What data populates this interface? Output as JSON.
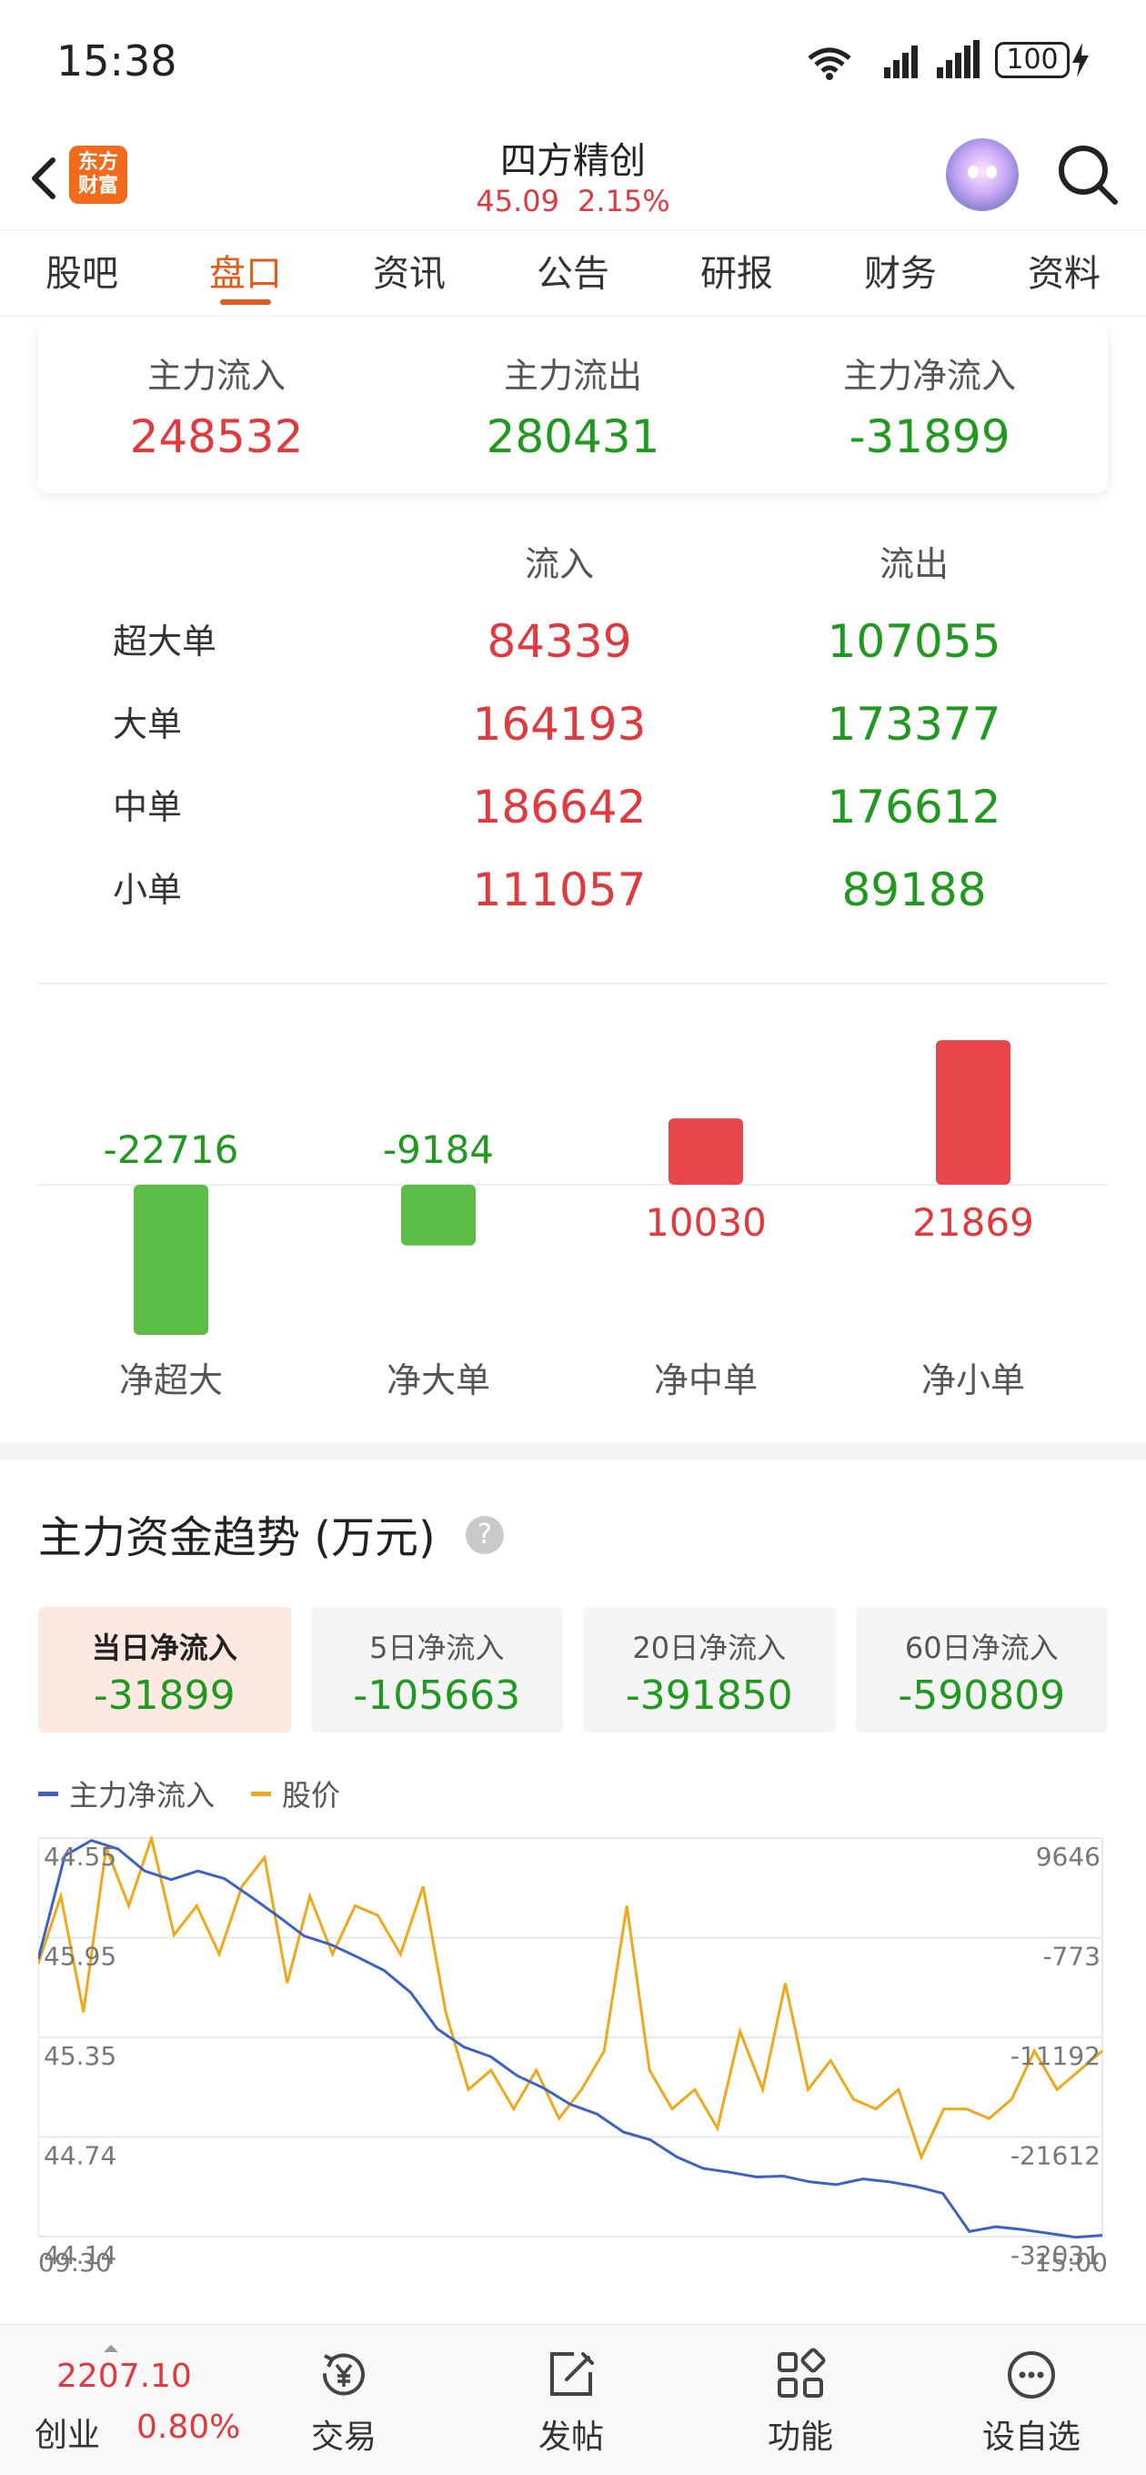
{
  "status_bar": {
    "time": "15:38",
    "wifi_label": "6",
    "network_label": "4G",
    "battery": "100"
  },
  "header": {
    "app_logo_text": [
      "东方",
      "财富"
    ],
    "title": "四方精创",
    "price": "45.09",
    "change_pct": "2.15%"
  },
  "tabs": [
    {
      "label": "股吧",
      "active": false
    },
    {
      "label": "盘口",
      "active": true
    },
    {
      "label": "资讯",
      "active": false
    },
    {
      "label": "公告",
      "active": false
    },
    {
      "label": "研报",
      "active": false
    },
    {
      "label": "财务",
      "active": false
    },
    {
      "label": "资料",
      "active": false
    }
  ],
  "main_flow": [
    {
      "label": "主力流入",
      "value": "248532",
      "tone": "red"
    },
    {
      "label": "主力流出",
      "value": "280431",
      "tone": "green"
    },
    {
      "label": "主力净流入",
      "value": "-31899",
      "tone": "green"
    }
  ],
  "flow_table": {
    "headers": {
      "in": "流入",
      "out": "流出"
    },
    "rows": [
      {
        "label": "超大单",
        "in": "84339",
        "out": "107055"
      },
      {
        "label": "大单",
        "in": "164193",
        "out": "173377"
      },
      {
        "label": "中单",
        "in": "186642",
        "out": "176612"
      },
      {
        "label": "小单",
        "in": "111057",
        "out": "89188"
      }
    ]
  },
  "chart_data": [
    {
      "type": "bar",
      "categories": [
        "净超大",
        "净大单",
        "净中单",
        "净小单"
      ],
      "values": [
        -22716,
        -9184,
        10030,
        21869
      ],
      "data_labels": [
        "-22716",
        "-9184",
        "10030",
        "21869"
      ],
      "colors": {
        "positive": "#e9464b",
        "negative": "#5bbd46"
      }
    },
    {
      "type": "line",
      "title": "主力资金趋势 (万元)",
      "x_ticks": [
        "09:30",
        "15:00"
      ],
      "left_axis_ticks": [
        "44.55",
        "45.95",
        "45.35",
        "44.74",
        "44.14"
      ],
      "right_axis_ticks": [
        "9646",
        "-773",
        "-11192",
        "-21612",
        "-32031"
      ],
      "series": [
        {
          "name": "主力净流入",
          "color": "#3d62c4",
          "values": [
            -3000,
            7800,
            9400,
            8500,
            6200,
            5300,
            6200,
            5400,
            3500,
            1500,
            -600,
            -1500,
            -2800,
            -4200,
            -6500,
            -10300,
            -12200,
            -13200,
            -15200,
            -16500,
            -18200,
            -19200,
            -21100,
            -21900,
            -23700,
            -24900,
            -25300,
            -25800,
            -25700,
            -26300,
            -26600,
            -26000,
            -26300,
            -26800,
            -27500,
            -31500,
            -31000,
            -31300,
            -31700,
            -32100,
            -31900
          ]
        },
        {
          "name": "股价",
          "color": "#f0a81a",
          "values": [
            45.55,
            45.9,
            45.3,
            46.15,
            45.85,
            46.2,
            45.7,
            45.85,
            45.6,
            45.95,
            46.1,
            45.45,
            45.9,
            45.6,
            45.85,
            45.8,
            45.6,
            45.95,
            45.3,
            44.9,
            45.0,
            44.8,
            45.0,
            44.75,
            44.9,
            45.1,
            45.85,
            45.0,
            44.8,
            44.9,
            44.7,
            45.2,
            44.9,
            45.45,
            44.9,
            45.05,
            44.85,
            44.8,
            44.9,
            44.55,
            44.8,
            44.8,
            44.75,
            44.85,
            45.1,
            44.9,
            45.0,
            45.1
          ]
        }
      ]
    }
  ],
  "bottom_nav": {
    "index": {
      "value": "2207.10",
      "name": "创业",
      "pct": "0.80%"
    },
    "items": [
      {
        "label": "交易",
        "icon": "trade-icon"
      },
      {
        "label": "发帖",
        "icon": "post-icon"
      },
      {
        "label": "功能",
        "icon": "grid-icon"
      },
      {
        "label": "设自选",
        "icon": "more-icon"
      }
    ]
  }
}
